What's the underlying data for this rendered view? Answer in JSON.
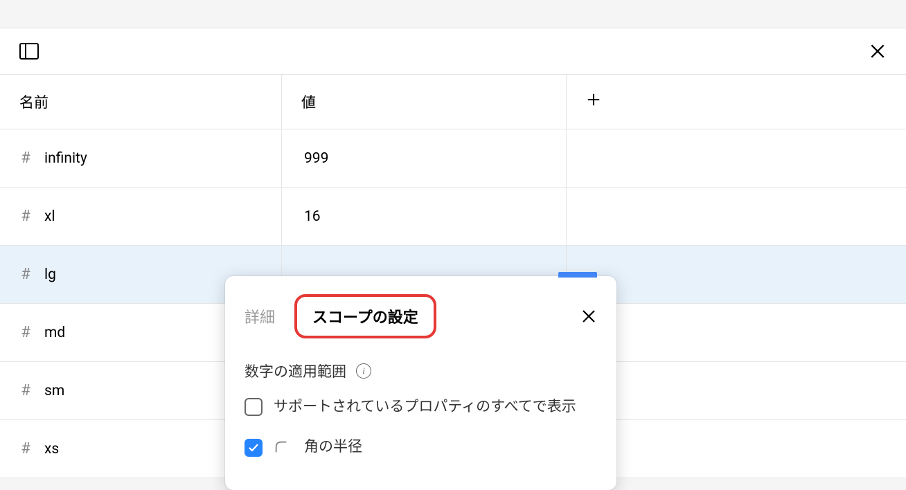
{
  "table": {
    "headers": {
      "name": "名前",
      "value": "値"
    },
    "rows": [
      {
        "name": "infinity",
        "value": "999"
      },
      {
        "name": "xl",
        "value": "16"
      },
      {
        "name": "lg",
        "value": ""
      },
      {
        "name": "md",
        "value": ""
      },
      {
        "name": "sm",
        "value": ""
      },
      {
        "name": "xs",
        "value": ""
      }
    ],
    "selected_index": 2
  },
  "popover": {
    "tabs": {
      "details": "詳細",
      "scope": "スコープの設定"
    },
    "section_label": "数字の適用範囲",
    "options": {
      "show_all": "サポートされているプロパティのすべてで表示",
      "corner_radius": "角の半径"
    }
  }
}
